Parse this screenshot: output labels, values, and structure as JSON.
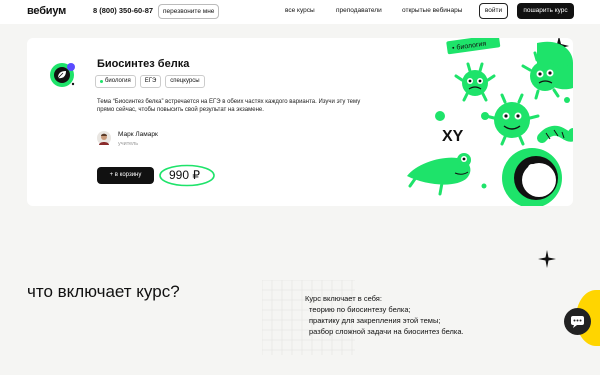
{
  "header": {
    "logo": "вебиум",
    "phone": "8 (800) 350-60-87",
    "callback": "перезвоните мне",
    "nav": [
      "все курсы",
      "преподаватели",
      "открытые вебинары"
    ],
    "login": "войти",
    "buy": "пошарить курс"
  },
  "course": {
    "title": "Биосинтез белка",
    "tags": [
      "биология",
      "ЕГЭ",
      "спецкурсы"
    ],
    "description": "Тема “Биосинтез белка” встречается на ЕГЭ в обеих частях каждого варианта. Изучи эту тему прямо сейчас, чтобы повысить свой результат на экзамене.",
    "teacher_name": "Марк Ламарк",
    "teacher_role": "учитель",
    "cart_label": "+ в корзину",
    "price": "990 ₽",
    "illustration_tag": "• биология",
    "illustration_text": "XY"
  },
  "section": {
    "title": "что включает курс?",
    "intro": "Курс включает в себя:",
    "items": [
      "теорию по биосинтезу белка;",
      "практику для закрепления этой темы;",
      "разбор сложной задачи на биосинтез белка."
    ]
  },
  "colors": {
    "accent": "#1ee36a",
    "dark": "#111111",
    "yellow": "#ffd500"
  },
  "icons": [
    "course-leaf-icon",
    "plus-icon",
    "star-icon",
    "chat-icon",
    "teacher-avatar"
  ]
}
